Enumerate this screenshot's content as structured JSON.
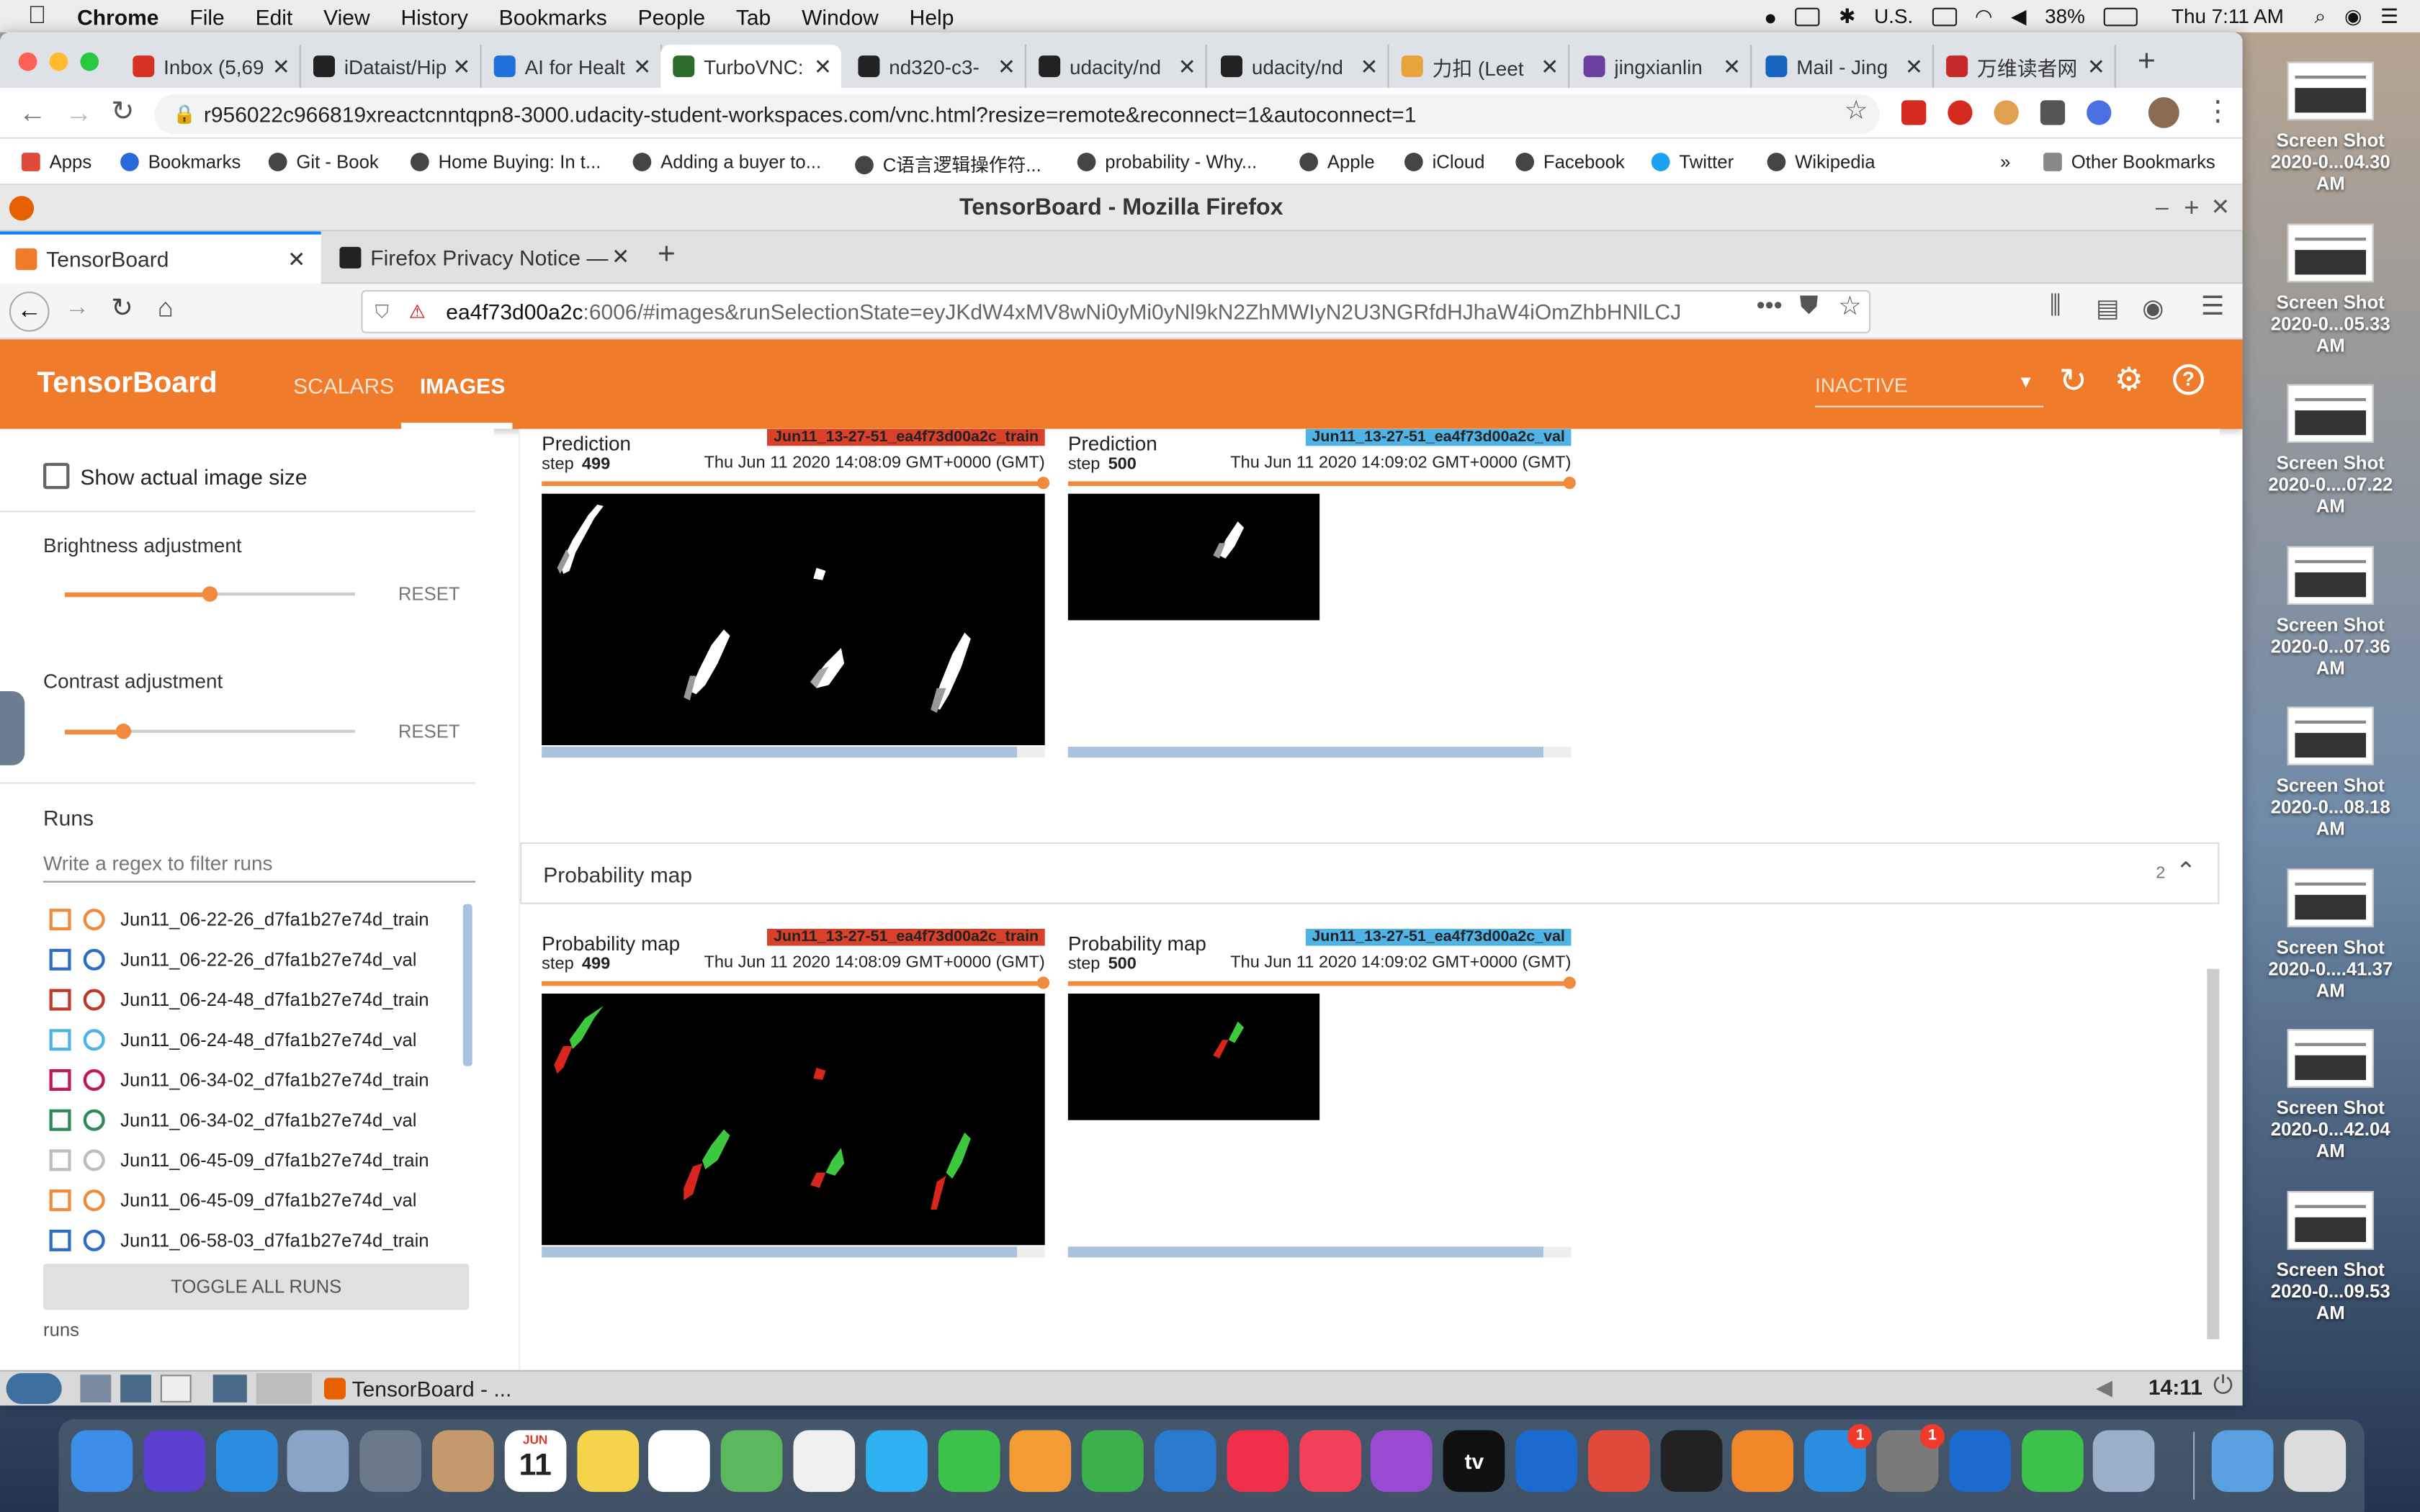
{
  "mac_menubar": {
    "app": "Chrome",
    "menus": [
      "File",
      "Edit",
      "View",
      "History",
      "Bookmarks",
      "People",
      "Tab",
      "Window",
      "Help"
    ],
    "input_source": "U.S.",
    "battery": "38%",
    "clock": "Thu 7:11 AM"
  },
  "chrome": {
    "tabs": [
      {
        "label": "Inbox (5,69",
        "color": "#d93025"
      },
      {
        "label": "iDataist/Hip",
        "color": "#222"
      },
      {
        "label": "AI for Healt",
        "color": "#1e6fd9"
      },
      {
        "label": "TurboVNC:",
        "color": "#2b6b2b"
      },
      {
        "label": "nd320-c3-",
        "color": "#222"
      },
      {
        "label": "udacity/nd",
        "color": "#222"
      },
      {
        "label": "udacity/nd",
        "color": "#222"
      },
      {
        "label": "力扣 (Leet",
        "color": "#e8a33d"
      },
      {
        "label": "jingxianlin",
        "color": "#6b3fa0"
      },
      {
        "label": "Mail - Jing",
        "color": "#1565c0"
      },
      {
        "label": "万维读者网",
        "color": "#c62828"
      }
    ],
    "active_tab_index": 3,
    "url": "r956022c966819xreactcnntqpn8-3000.udacity-student-workspaces.com/vnc.html?resize=remote&reconnect=1&autoconnect=1",
    "bookmarks": [
      "Apps",
      "Bookmarks",
      "Git - Book",
      "Home Buying: In t...",
      "Adding a buyer to...",
      "C语言逻辑操作符...",
      "probability - Why...",
      "Apple",
      "iCloud",
      "Facebook",
      "Twitter",
      "Wikipedia"
    ],
    "overflow": "»",
    "other_bookmarks": "Other Bookmarks"
  },
  "firefox": {
    "window_title": "TensorBoard - Mozilla Firefox",
    "tabs": [
      "TensorBoard",
      "Firefox Privacy Notice —"
    ],
    "url_host": "ea4f73d00a2c",
    "url_rest": ":6006/#images&runSelectionState=eyJKdW4xMV8wNi0yMi0yNl9kN2ZhMWIyN2U3NGRfdHJhaW4iOmZhbHNlLCJ"
  },
  "tensorboard": {
    "logo": "TensorBoard",
    "nav": [
      "SCALARS",
      "IMAGES"
    ],
    "active_nav": "IMAGES",
    "reload_select": "INACTIVE",
    "sidebar": {
      "show_actual_size": "Show actual image size",
      "brightness_label": "Brightness adjustment",
      "brightness_value": 0.5,
      "contrast_label": "Contrast adjustment",
      "contrast_value": 0.2,
      "reset": "RESET",
      "runs_title": "Runs",
      "filter_placeholder": "Write a regex to filter runs",
      "runs": [
        {
          "name": "Jun11_06-22-26_d7fa1b27e74d_train",
          "color": "#f08a3c"
        },
        {
          "name": "Jun11_06-22-26_d7fa1b27e74d_val",
          "color": "#2f6dc0"
        },
        {
          "name": "Jun11_06-24-48_d7fa1b27e74d_train",
          "color": "#c0392b"
        },
        {
          "name": "Jun11_06-24-48_d7fa1b27e74d_val",
          "color": "#4fb3e6"
        },
        {
          "name": "Jun11_06-34-02_d7fa1b27e74d_train",
          "color": "#c2185b"
        },
        {
          "name": "Jun11_06-34-02_d7fa1b27e74d_val",
          "color": "#2e8b57"
        },
        {
          "name": "Jun11_06-45-09_d7fa1b27e74d_train",
          "color": "#bdbdbd"
        },
        {
          "name": "Jun11_06-45-09_d7fa1b27e74d_val",
          "color": "#f08a3c"
        },
        {
          "name": "Jun11_06-58-03_d7fa1b27e74d_train",
          "color": "#2f6dc0"
        }
      ],
      "toggle_all": "TOGGLE ALL RUNS",
      "footer": "runs"
    },
    "prediction_cards": [
      {
        "title": "Prediction",
        "step_label": "step",
        "step": "499",
        "time": "Thu Jun 11 2020 14:08:09 GMT+0000 (GMT)",
        "run": "Jun11_13-27-51_ea4f73d00a2c_train",
        "chip": "#d9412b"
      },
      {
        "title": "Prediction",
        "step_label": "step",
        "step": "500",
        "time": "Thu Jun 11 2020 14:09:02 GMT+0000 (GMT)",
        "run": "Jun11_13-27-51_ea4f73d00a2c_val",
        "chip": "#4fb3e6"
      }
    ],
    "prob_section": {
      "title": "Probability map",
      "count": "2"
    },
    "prob_cards": [
      {
        "title": "Probability map",
        "step_label": "step",
        "step": "499",
        "time": "Thu Jun 11 2020 14:08:09 GMT+0000 (GMT)",
        "run": "Jun11_13-27-51_ea4f73d00a2c_train",
        "chip": "#d9412b"
      },
      {
        "title": "Probability map",
        "step_label": "step",
        "step": "500",
        "time": "Thu Jun 11 2020 14:09:02 GMT+0000 (GMT)",
        "run": "Jun11_13-27-51_ea4f73d00a2c_val",
        "chip": "#4fb3e6"
      }
    ]
  },
  "vnc_taskbar": {
    "window": "TensorBoard - ...",
    "clock": "14:11"
  },
  "desktop_shots": [
    {
      "line1": "Screen Shot",
      "line2": "2020-0...04.30 AM"
    },
    {
      "line1": "Screen Shot",
      "line2": "2020-0...05.33 AM"
    },
    {
      "line1": "Screen Shot",
      "line2": "2020-0....07.22 AM"
    },
    {
      "line1": "Screen Shot",
      "line2": "2020-0...07.36 AM"
    },
    {
      "line1": "Screen Shot",
      "line2": "2020-0...08.18 AM"
    },
    {
      "line1": "Screen Shot",
      "line2": "2020-0....41.37 AM"
    },
    {
      "line1": "Screen Shot",
      "line2": "2020-0...42.04 AM"
    },
    {
      "line1": "Screen Shot",
      "line2": "2020-0...09.53 AM"
    }
  ],
  "dock": {
    "calendar_month": "JUN",
    "calendar_day": "11",
    "appletv": "tv",
    "badges": [
      "1",
      "1"
    ],
    "apps": [
      {
        "name": "finder",
        "color": "#3d8ee8"
      },
      {
        "name": "siri",
        "color": "#5a3fd1"
      },
      {
        "name": "safari",
        "color": "#2a8de0"
      },
      {
        "name": "preview",
        "color": "#8aa4c8"
      },
      {
        "name": "launchpad",
        "color": "#6a7a8a"
      },
      {
        "name": "contacts",
        "color": "#c49a6c"
      },
      {
        "name": "calendar",
        "color": "#ffffff"
      },
      {
        "name": "notes",
        "color": "#f5d34a"
      },
      {
        "name": "reminders",
        "color": "#ffffff"
      },
      {
        "name": "maps",
        "color": "#5cb85c"
      },
      {
        "name": "photos",
        "color": "#f0f0f0"
      },
      {
        "name": "messages",
        "color": "#2fb0f0"
      },
      {
        "name": "facetime",
        "color": "#3cc24a"
      },
      {
        "name": "pages",
        "color": "#f39c33"
      },
      {
        "name": "numbers",
        "color": "#3cb04a"
      },
      {
        "name": "keynote",
        "color": "#2a7ad0"
      },
      {
        "name": "news",
        "color": "#f0304a"
      },
      {
        "name": "music",
        "color": "#f0405a"
      },
      {
        "name": "podcasts",
        "color": "#9a4ad0"
      },
      {
        "name": "appletv",
        "color": "#111111"
      },
      {
        "name": "outlook",
        "color": "#1a6ad0"
      },
      {
        "name": "chrome",
        "color": "#e04a3a"
      },
      {
        "name": "terminal",
        "color": "#222222"
      },
      {
        "name": "books",
        "color": "#f0882a"
      },
      {
        "name": "appstore",
        "color": "#2a8de0"
      },
      {
        "name": "system-preferences",
        "color": "#7a7a7a"
      },
      {
        "name": "teamviewer",
        "color": "#1a6ad0"
      },
      {
        "name": "wechat",
        "color": "#3cc24a"
      },
      {
        "name": "image-capture",
        "color": "#9ab0c8"
      },
      {
        "name": "folder",
        "color": "#5aa0e0"
      },
      {
        "name": "trash",
        "color": "#dcdcdc"
      }
    ]
  }
}
